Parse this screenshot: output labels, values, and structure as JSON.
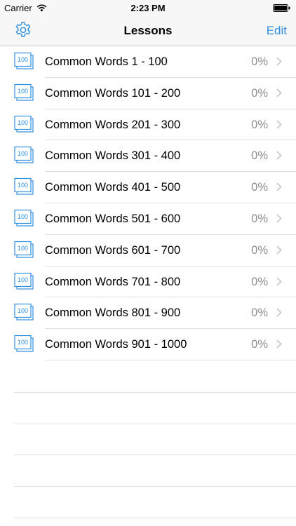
{
  "status_bar": {
    "carrier": "Carrier",
    "time": "2:23 PM",
    "wifi_icon": "wifi-icon",
    "battery_icon": "battery-icon"
  },
  "nav": {
    "title": "Lessons",
    "edit_label": "Edit",
    "settings_icon": "gear-icon"
  },
  "colors": {
    "accent": "#2f8ee0",
    "secondary_text": "#8e8e93",
    "separator": "#e0e0e4",
    "bar_background": "#f7f7f7"
  },
  "lesson_icon": {
    "name": "flashcard-100-icon",
    "text": "100"
  },
  "lessons": [
    {
      "label": "Common Words 1 - 100",
      "progress": "0%"
    },
    {
      "label": "Common Words 101 - 200",
      "progress": "0%"
    },
    {
      "label": "Common Words 201 - 300",
      "progress": "0%"
    },
    {
      "label": "Common Words 301 - 400",
      "progress": "0%"
    },
    {
      "label": "Common Words 401 - 500",
      "progress": "0%"
    },
    {
      "label": "Common Words 501 - 600",
      "progress": "0%"
    },
    {
      "label": "Common Words 601 - 700",
      "progress": "0%"
    },
    {
      "label": "Common Words 701 - 800",
      "progress": "0%"
    },
    {
      "label": "Common Words 801 - 900",
      "progress": "0%"
    },
    {
      "label": "Common Words 901 - 1000",
      "progress": "0%"
    }
  ]
}
